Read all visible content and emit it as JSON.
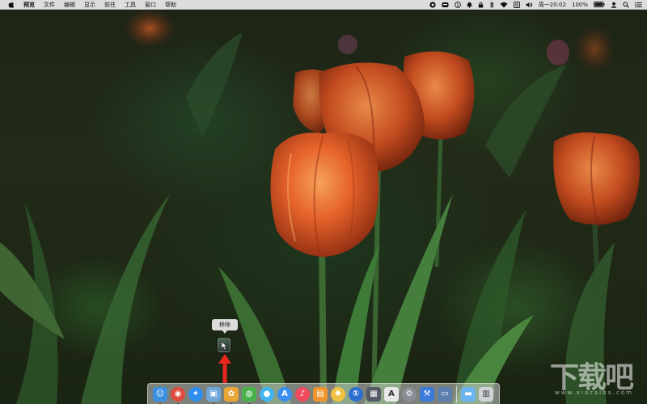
{
  "menubar": {
    "apple_icon": "apple-icon",
    "app_name": "预览",
    "menus": [
      "文件",
      "编辑",
      "显示",
      "前往",
      "工具",
      "窗口",
      "帮助"
    ],
    "tray_icons": [
      "screen-record-icon",
      "cloud-icon",
      "info-icon",
      "bell-icon",
      "lock-icon",
      "bluetooth-icon",
      "wifi-icon",
      "input-method-icon",
      "volume-icon"
    ],
    "clock": "周一20:02",
    "battery_percent": "100%",
    "battery_level": 1.0,
    "right_icons": [
      "user-icon",
      "spotlight-icon",
      "notification-center-icon"
    ]
  },
  "desktop": {
    "tooltip": "移除",
    "dragged_icon": "app-icon"
  },
  "dock": {
    "items": [
      {
        "name": "finder-icon",
        "color": "#3b8fe0",
        "running": true
      },
      {
        "name": "chrome-icon",
        "color": "#e04a3a",
        "running": true
      },
      {
        "name": "safari-icon",
        "color": "#2d8ef0",
        "running": false
      },
      {
        "name": "preview-icon",
        "color": "#6fa7d8",
        "running": true
      },
      {
        "name": "butterfly-app-icon",
        "color": "#e8a637",
        "running": true
      },
      {
        "name": "wechat-icon",
        "color": "#49b24a",
        "running": true
      },
      {
        "name": "messages-icon",
        "color": "#41b5f0",
        "running": false
      },
      {
        "name": "app-store-icon",
        "color": "#3a8ff0",
        "running": false
      },
      {
        "name": "music-icon",
        "color": "#f04a5c",
        "running": false
      },
      {
        "name": "books-icon",
        "color": "#f0952d",
        "running": false
      },
      {
        "name": "photos-icon",
        "color": "#f0c040",
        "running": false
      },
      {
        "name": "1password-icon",
        "color": "#2d6fd0",
        "running": false
      },
      {
        "name": "clapper-icon",
        "color": "#555a66",
        "running": false
      },
      {
        "name": "font-book-icon",
        "color": "#e8e8e8",
        "running": false
      },
      {
        "name": "system-preferences-icon",
        "color": "#8a8e96",
        "running": false
      },
      {
        "name": "xcode-icon",
        "color": "#3a7ad8",
        "running": false
      },
      {
        "name": "screenshot-icon",
        "color": "#5c7fb0",
        "running": false
      },
      {
        "name": "folder-icon",
        "color": "#6cb4ef",
        "running": false
      },
      {
        "name": "trash-icon",
        "color": "#cfd3d8",
        "running": false
      }
    ]
  },
  "watermark": {
    "brand": "下载吧",
    "url": "www.xiazaiba.com"
  }
}
